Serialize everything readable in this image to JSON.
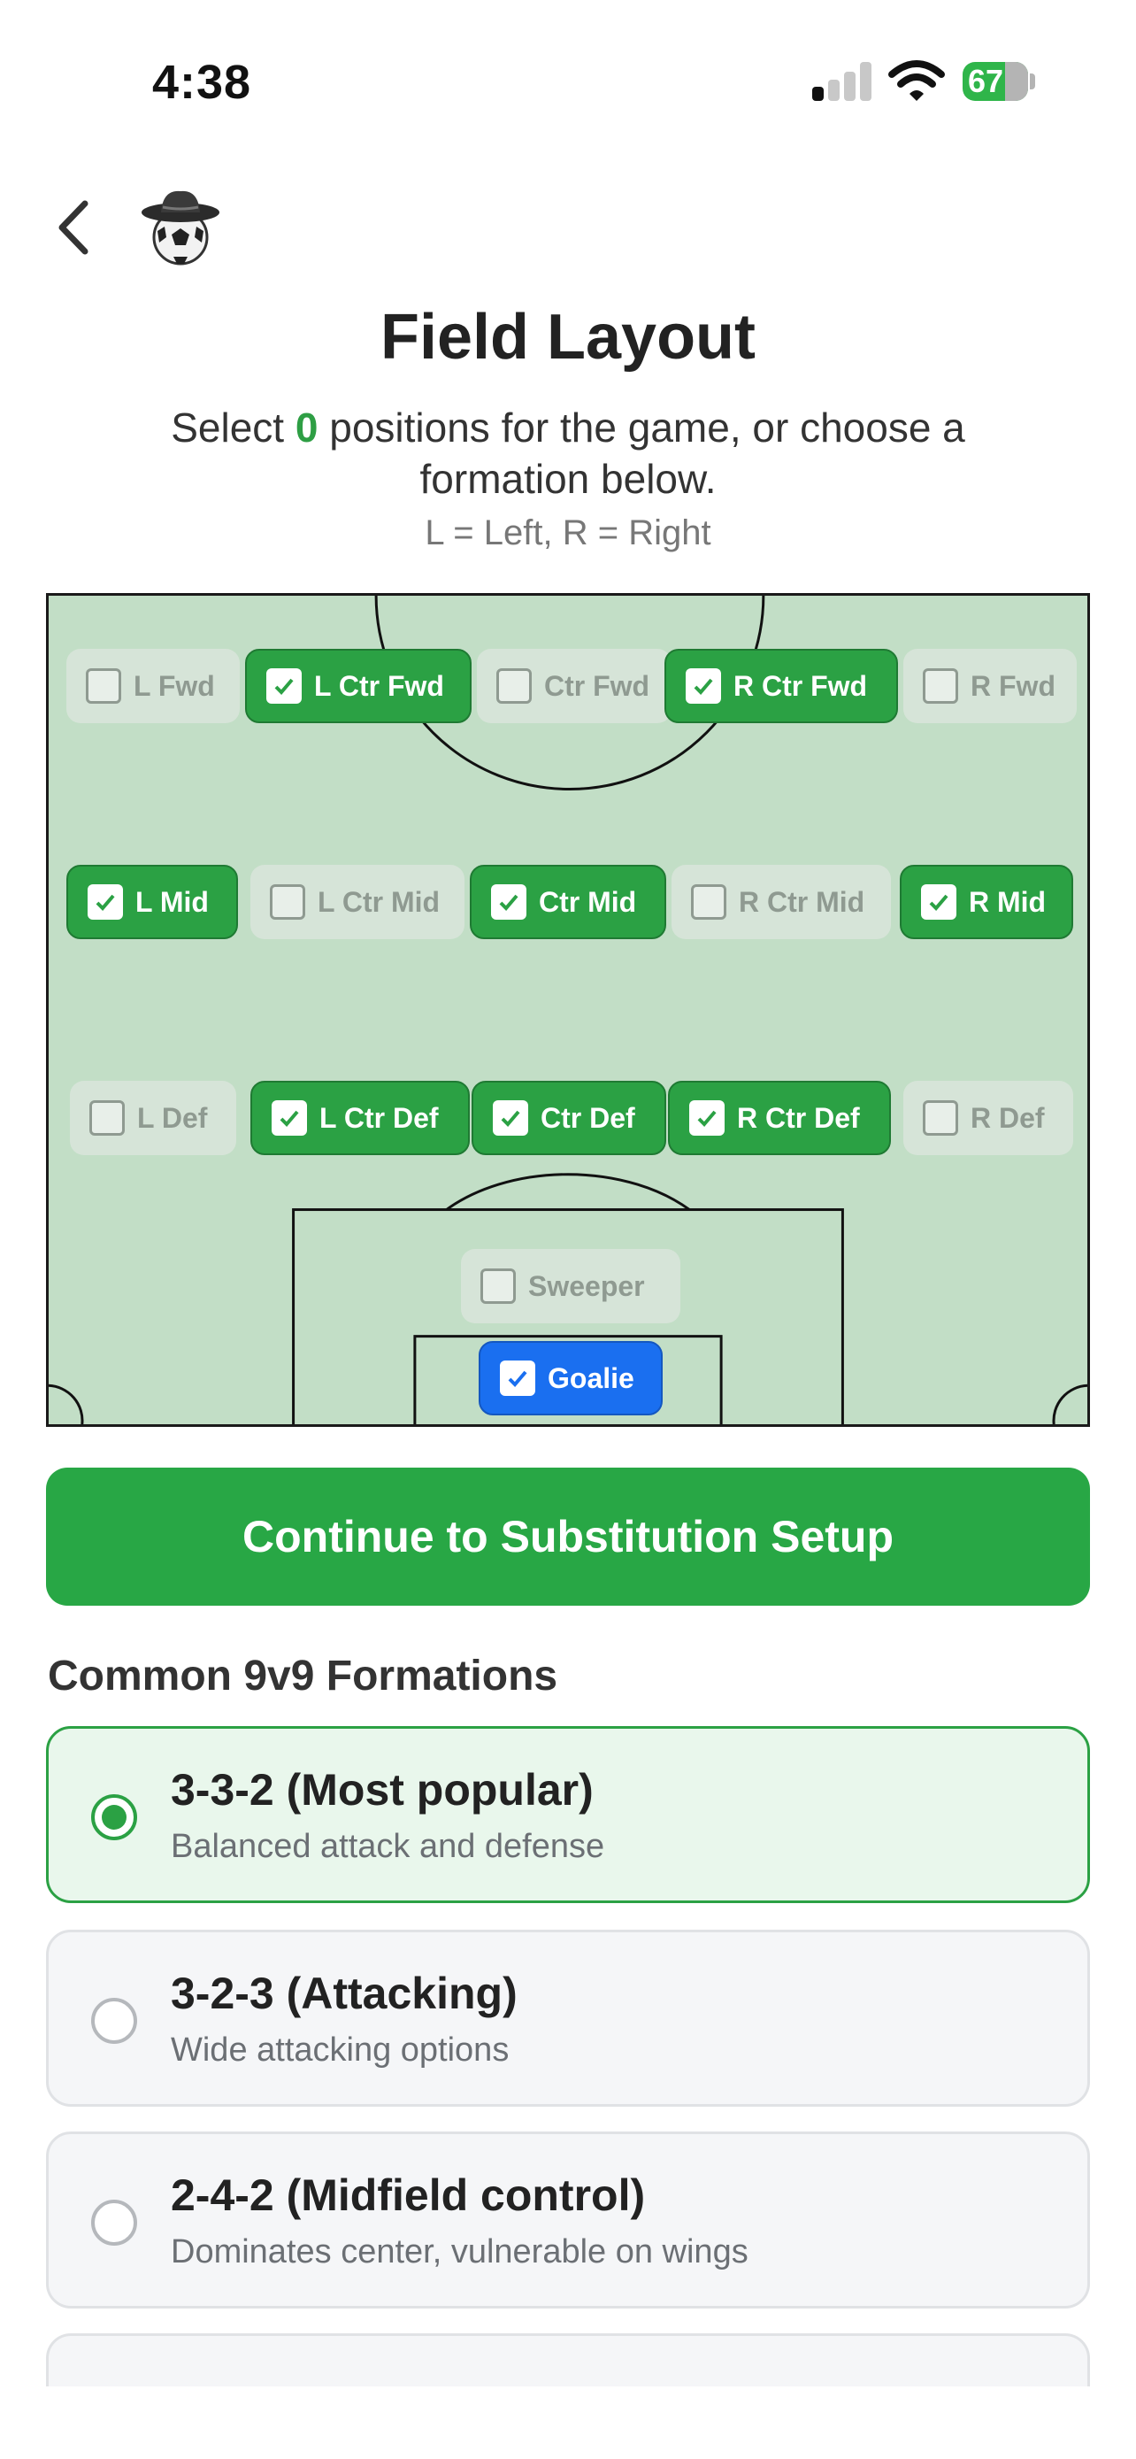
{
  "status": {
    "time": "4:38",
    "battery": "67"
  },
  "header": {
    "title": "Field Layout"
  },
  "instructions": {
    "prefix": "Select",
    "count": "0",
    "suffix": "positions for the game, or choose a formation below.",
    "note": "L = Left, R = Right"
  },
  "positions": {
    "l_fwd": "L Fwd",
    "l_ctr_fwd": "L Ctr Fwd",
    "ctr_fwd": "Ctr Fwd",
    "r_ctr_fwd": "R Ctr Fwd",
    "r_fwd": "R Fwd",
    "l_mid": "L Mid",
    "l_ctr_mid": "L Ctr Mid",
    "ctr_mid": "Ctr Mid",
    "r_ctr_mid": "R Ctr Mid",
    "r_mid": "R Mid",
    "l_def": "L Def",
    "l_ctr_def": "L Ctr Def",
    "ctr_def": "Ctr Def",
    "r_ctr_def": "R Ctr Def",
    "r_def": "R Def",
    "sweeper": "Sweeper",
    "goalie": "Goalie"
  },
  "selected_positions": [
    "L Ctr Fwd",
    "R Ctr Fwd",
    "L Mid",
    "Ctr Mid",
    "R Mid",
    "L Ctr Def",
    "Ctr Def",
    "R Ctr Def",
    "Goalie"
  ],
  "continue_label": "Continue to Substitution Setup",
  "formations_title": "Common 9v9 Formations",
  "formations": [
    {
      "name": "3-3-2 (Most popular)",
      "desc": "Balanced attack and defense",
      "selected": true
    },
    {
      "name": "3-2-3 (Attacking)",
      "desc": "Wide attacking options",
      "selected": false
    },
    {
      "name": "2-4-2 (Midfield control)",
      "desc": "Dominates center, vulnerable on wings",
      "selected": false
    }
  ],
  "colors": {
    "accent_green": "#28a745",
    "goalie_blue": "#1a6ff0",
    "field_green": "#c2dec6"
  },
  "icons": {
    "back": "chevron-left-icon",
    "avatar": "soccer-ball-cowboy-hat-icon",
    "check": "checkmark-icon"
  }
}
